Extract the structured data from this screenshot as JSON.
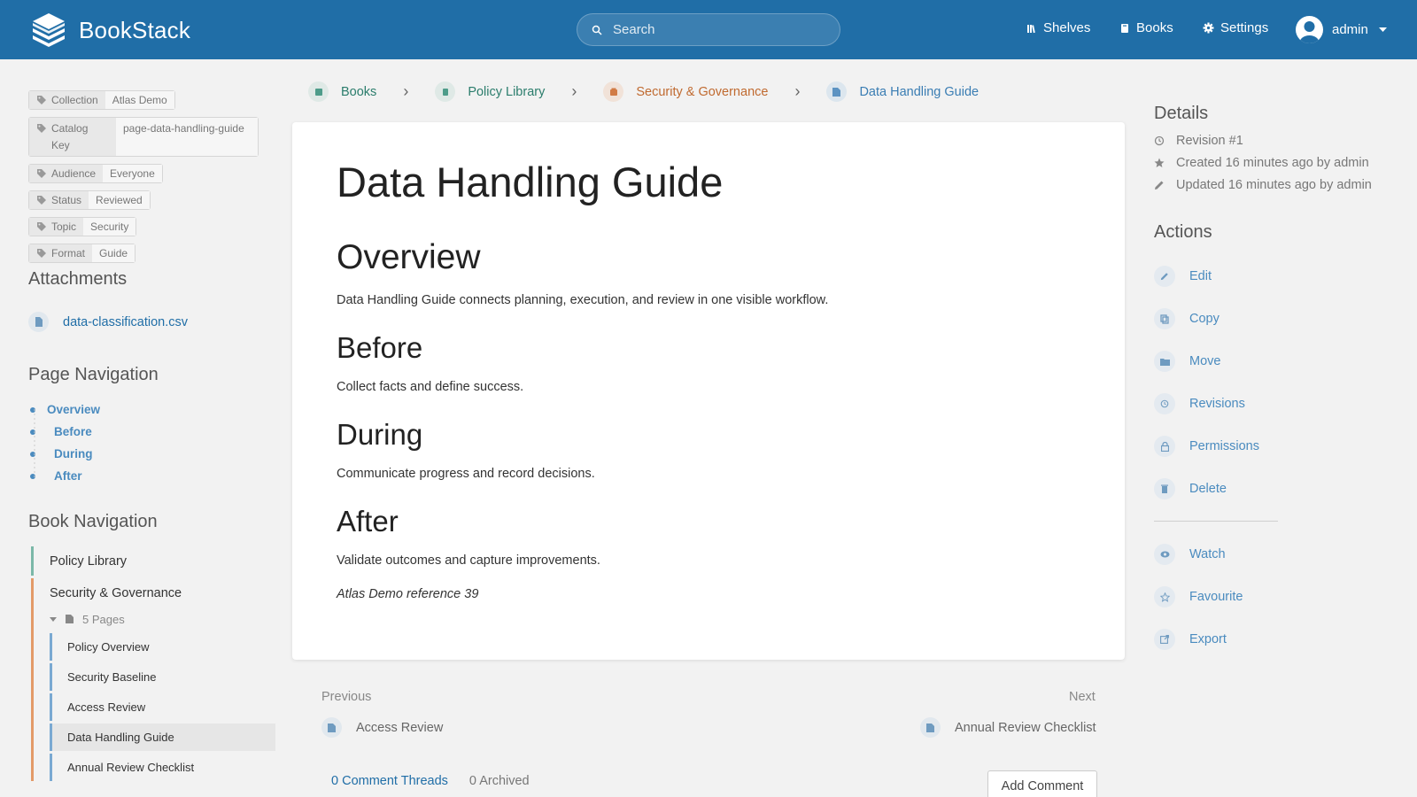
{
  "header": {
    "app_name": "BookStack",
    "search_placeholder": "Search",
    "nav": {
      "shelves": "Shelves",
      "books": "Books",
      "settings": "Settings"
    },
    "user": "admin"
  },
  "tags": [
    {
      "key": "Collection",
      "value": "Atlas Demo"
    },
    {
      "key": "Catalog Key",
      "value": "page-data-handling-guide"
    },
    {
      "key": "Audience",
      "value": "Everyone"
    },
    {
      "key": "Status",
      "value": "Reviewed"
    },
    {
      "key": "Topic",
      "value": "Security"
    },
    {
      "key": "Format",
      "value": "Guide"
    }
  ],
  "attachments": {
    "title": "Attachments",
    "file": "data-classification.csv"
  },
  "page_nav": {
    "title": "Page Navigation",
    "items": [
      "Overview",
      "Before",
      "During",
      "After"
    ]
  },
  "book_nav": {
    "title": "Book Navigation",
    "book": "Policy Library",
    "chapter": "Security & Governance",
    "pages_toggle": "5 Pages",
    "pages": [
      "Policy Overview",
      "Security Baseline",
      "Access Review",
      "Data Handling Guide",
      "Annual Review Checklist"
    ]
  },
  "breadcrumbs": [
    "Books",
    "Policy Library",
    "Security & Governance",
    "Data Handling Guide"
  ],
  "content": {
    "title": "Data Handling Guide",
    "overview_h": "Overview",
    "overview_p": "Data Handling Guide connects planning, execution, and review in one visible workflow.",
    "before_h": "Before",
    "before_p": "Collect facts and define success.",
    "during_h": "During",
    "during_p": "Communicate progress and record decisions.",
    "after_h": "After",
    "after_p": "Validate outcomes and capture improvements.",
    "reference": "Atlas Demo reference 39"
  },
  "prev_next": {
    "prev_label": "Previous",
    "prev_page": "Access Review",
    "next_label": "Next",
    "next_page": "Annual Review Checklist"
  },
  "comments": {
    "threads": "0 Comment Threads",
    "archived": "0 Archived",
    "add": "Add Comment"
  },
  "details": {
    "title": "Details",
    "revision": "Revision #1",
    "created": "Created 16 minutes ago by admin",
    "updated": "Updated 16 minutes ago by admin"
  },
  "actions": {
    "title": "Actions",
    "edit": "Edit",
    "copy": "Copy",
    "move": "Move",
    "revisions": "Revisions",
    "permissions": "Permissions",
    "delete": "Delete",
    "watch": "Watch",
    "favourite": "Favourite",
    "export": "Export"
  },
  "colors": {
    "header": "#206ea7",
    "link": "#206ea7",
    "book": "#077b70",
    "chapter": "#af4d0d",
    "page": "#206ea7"
  }
}
